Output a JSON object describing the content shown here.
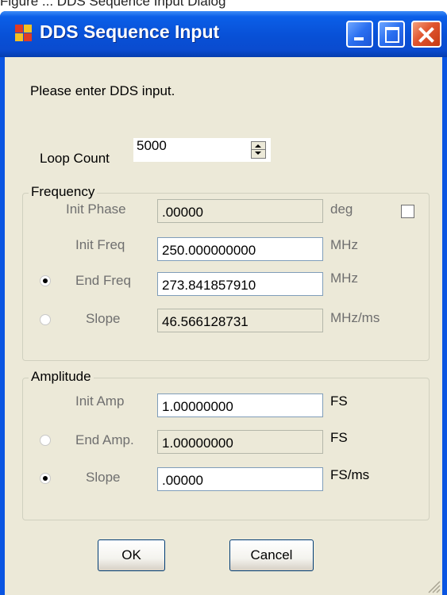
{
  "background": {
    "partial_text": "Figure ... DDS Sequence Input Dialog"
  },
  "window": {
    "title": "DDS Sequence Input",
    "controls": {
      "minimize": "minimize-icon",
      "maximize": "maximize-icon",
      "close": "close-icon"
    },
    "colors": {
      "titlebar": "#0a55e2",
      "client": "#ece9d8",
      "close_button": "#e0542e"
    }
  },
  "prompt": "Please enter DDS input.",
  "loop_count": {
    "label": "Loop Count",
    "value": "5000"
  },
  "frequency": {
    "group_title": "Frequency",
    "init_phase": {
      "label": "Init Phase",
      "value": ".00000",
      "unit": "deg",
      "checked": false
    },
    "init_freq": {
      "label": "Init Freq",
      "value": "250.000000000",
      "unit": "MHz"
    },
    "end_freq": {
      "label": "End Freq",
      "value": "273.841857910",
      "unit": "MHz",
      "selected": true
    },
    "slope": {
      "label": "Slope",
      "value": "46.566128731",
      "unit": "MHz/ms",
      "selected": false
    }
  },
  "amplitude": {
    "group_title": "Amplitude",
    "init_amp": {
      "label": "Init Amp",
      "value": "1.00000000",
      "unit": "FS"
    },
    "end_amp": {
      "label": "End Amp.",
      "value": "1.00000000",
      "unit": "FS",
      "selected": false
    },
    "slope": {
      "label": "Slope",
      "value": ".00000",
      "unit": "FS/ms",
      "selected": true
    }
  },
  "buttons": {
    "ok": "OK",
    "cancel": "Cancel"
  }
}
